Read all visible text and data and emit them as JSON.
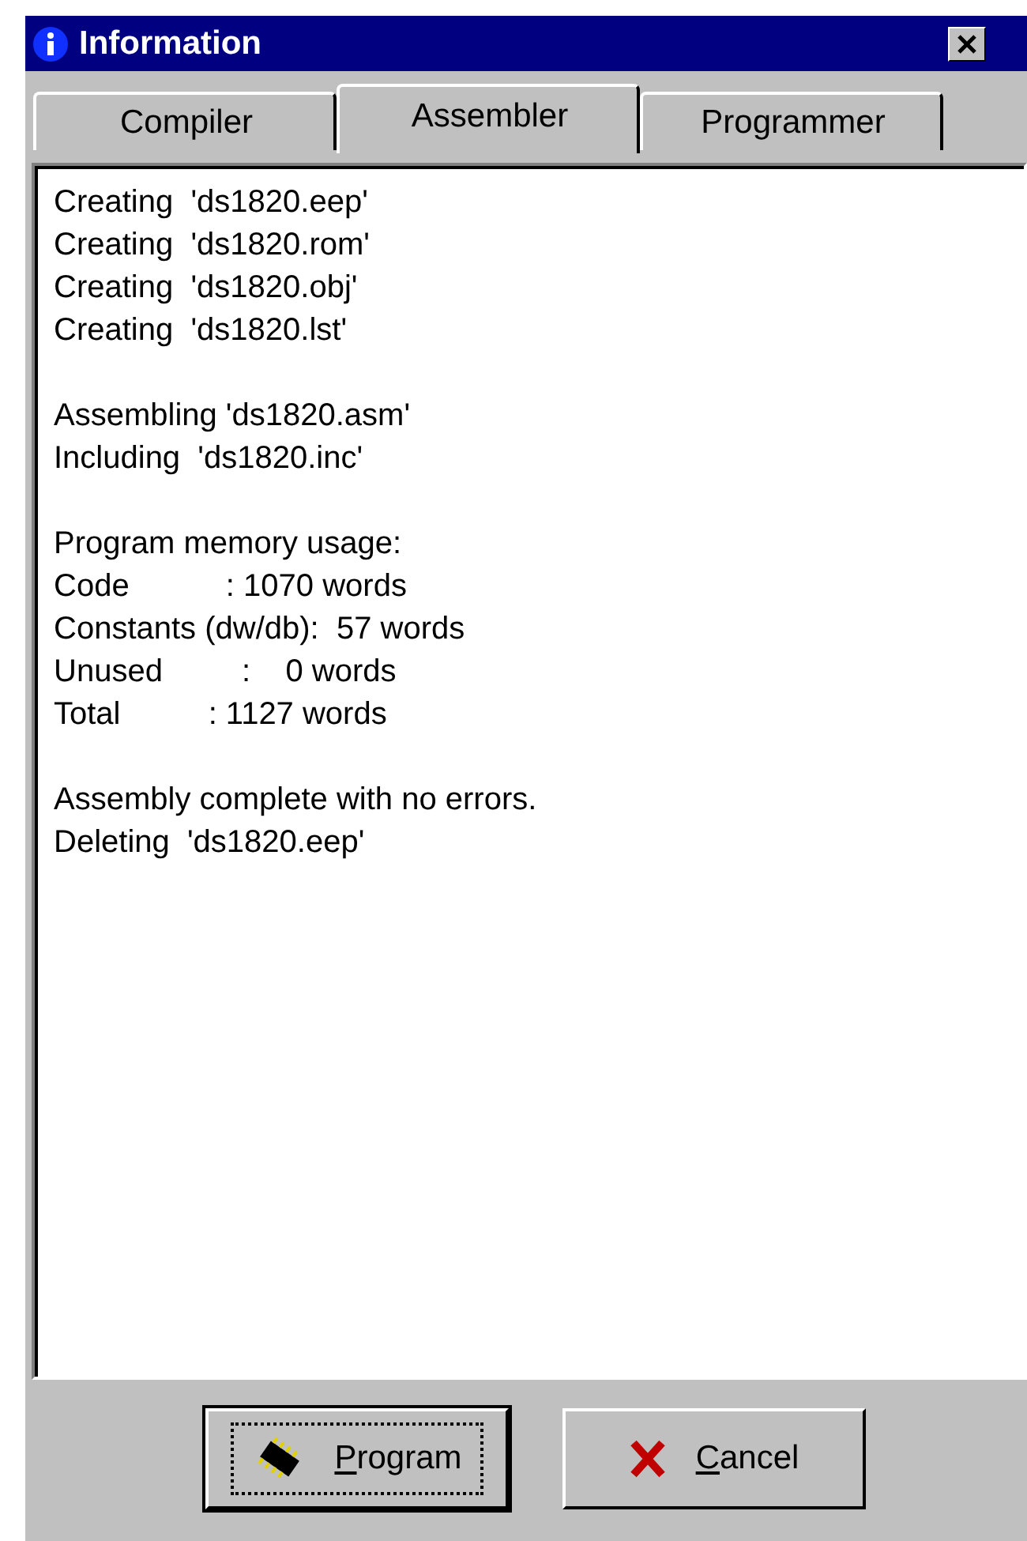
{
  "window": {
    "title": "Information"
  },
  "tabs": [
    {
      "label": "Compiler",
      "selected": false
    },
    {
      "label": "Assembler",
      "selected": true
    },
    {
      "label": "Programmer",
      "selected": false
    }
  ],
  "log": {
    "paragraphs": [
      [
        "Creating  'ds1820.eep'",
        "Creating  'ds1820.rom'",
        "Creating  'ds1820.obj'",
        "Creating  'ds1820.lst'"
      ],
      [
        "Assembling 'ds1820.asm'",
        "Including  'ds1820.inc'"
      ],
      [
        "Program memory usage:",
        "Code           : 1070 words",
        "Constants (dw/db):  57 words",
        "Unused         :    0 words",
        "Total          : 1127 words"
      ],
      [
        "Assembly complete with no errors.",
        "Deleting  'ds1820.eep'"
      ]
    ]
  },
  "buttons": [
    {
      "kind": "program",
      "label": "Program",
      "focused": true,
      "mnemonic": true
    },
    {
      "kind": "cancel",
      "label": "Cancel",
      "focused": false,
      "mnemonic": true
    }
  ]
}
